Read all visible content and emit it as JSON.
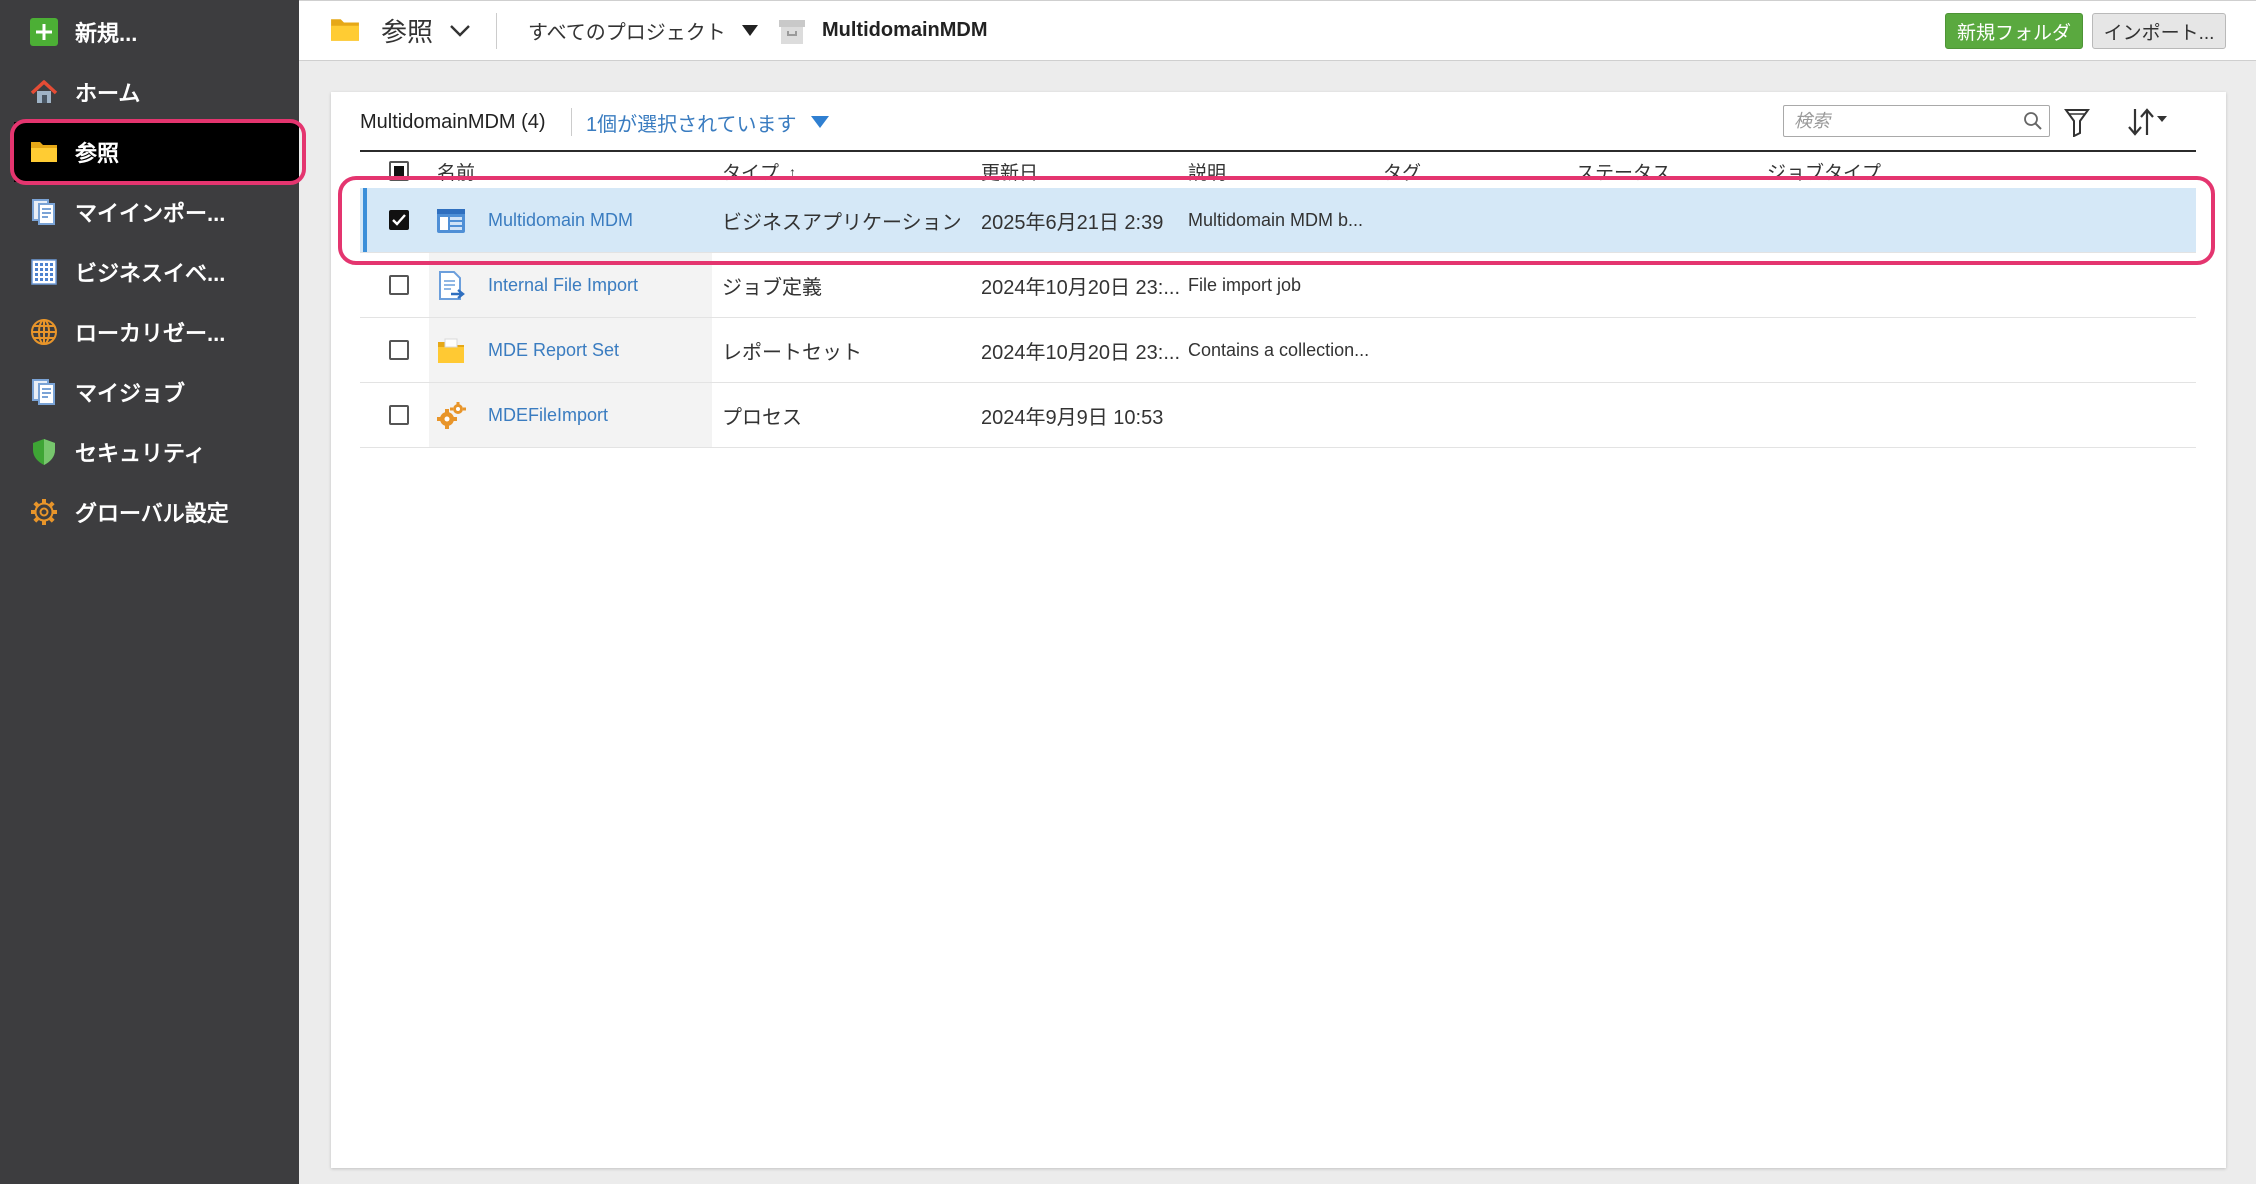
{
  "sidebar": {
    "items": [
      {
        "label": "新規...",
        "icon": "plus-icon"
      },
      {
        "label": "ホーム",
        "icon": "home-icon"
      },
      {
        "label": "参照",
        "icon": "folder-icon",
        "active": true
      },
      {
        "label": "マイインポー...",
        "icon": "document-stack-icon"
      },
      {
        "label": "ビジネスイベ...",
        "icon": "grid-icon"
      },
      {
        "label": "ローカリゼー...",
        "icon": "globe-icon"
      },
      {
        "label": "マイジョブ",
        "icon": "document-stack-icon"
      },
      {
        "label": "セキュリティ",
        "icon": "shield-icon"
      },
      {
        "label": "グローバル設定",
        "icon": "gear-icon"
      }
    ]
  },
  "topbar": {
    "section_icon": "folder-icon",
    "section_label": "参照",
    "project_filter": "すべてのプロジェクト",
    "current_project_icon": "archive-box-icon",
    "current_project": "MultidomainMDM",
    "new_folder_button": "新規フォルダ",
    "import_button": "インポート..."
  },
  "panel": {
    "title": "MultidomainMDM (4)",
    "selection_status": "1個が選択されています",
    "search_placeholder": "検索"
  },
  "table": {
    "columns": [
      "名前",
      "タイプ",
      "更新日",
      "説明",
      "タグ",
      "ステータス",
      "ジョブタイプ"
    ],
    "sort_indicator": "↑",
    "header_checkbox_indeterminate": true,
    "rows": [
      {
        "checked": true,
        "icon": "business-app-icon",
        "name": "Multidomain MDM",
        "type": "ビジネスアプリケーション",
        "updated": "2025年6月21日 2:39",
        "description": "Multidomain MDM b..."
      },
      {
        "checked": false,
        "icon": "file-import-icon",
        "name": "Internal File Import",
        "type": "ジョブ定義",
        "updated": "2024年10月20日 23:...",
        "description": "File import job"
      },
      {
        "checked": false,
        "icon": "report-set-icon",
        "name": "MDE Report Set",
        "type": "レポートセット",
        "updated": "2024年10月20日 23:...",
        "description": "Contains a collection..."
      },
      {
        "checked": false,
        "icon": "process-gears-icon",
        "name": "MDEFileImport",
        "type": "プロセス",
        "updated": "2024年9月9日 10:53",
        "description": ""
      }
    ]
  },
  "colors": {
    "sidebar_bg": "#3d3d3f",
    "accent_green": "#5aa93f",
    "link_blue": "#3a7cc0",
    "selected_row_bg": "#d5e8f7",
    "highlight_pink": "#e4356f"
  }
}
